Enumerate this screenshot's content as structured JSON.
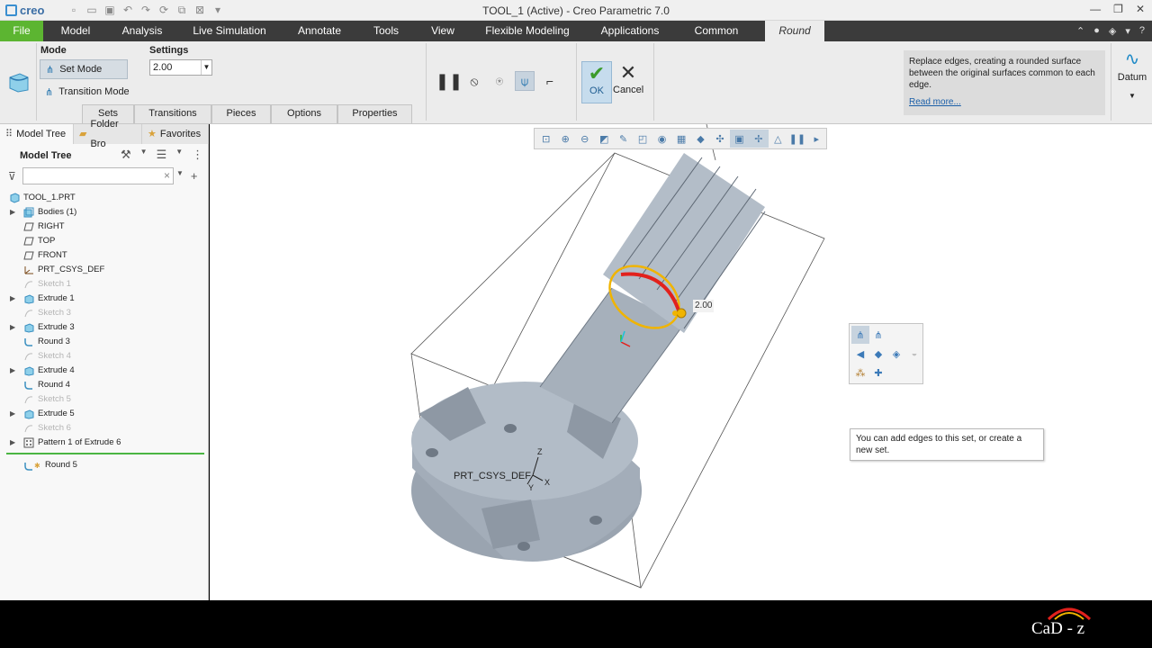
{
  "app": {
    "logo_text": "creo",
    "window_title": "TOOL_1 (Active) - Creo Parametric 7.0"
  },
  "tabs": [
    "File",
    "Model",
    "Analysis",
    "Live Simulation",
    "Annotate",
    "Tools",
    "View",
    "Flexible Modeling",
    "Applications",
    "Common",
    "Round"
  ],
  "ribbon": {
    "mode_label": "Mode",
    "settings_label": "Settings",
    "set_mode": "Set Mode",
    "transition_mode": "Transition Mode",
    "radius_value": "2.00",
    "subtabs": [
      "Sets",
      "Transitions",
      "Pieces",
      "Options",
      "Properties"
    ],
    "ok": "OK",
    "cancel": "Cancel",
    "help_text": "Replace edges, creating a rounded surface between the original surfaces common to each edge.",
    "read_more": "Read more...",
    "datum": "Datum"
  },
  "panel": {
    "tabs": [
      "Model Tree",
      "Folder Bro",
      "Favorites"
    ],
    "header": "Model Tree",
    "search_value": ""
  },
  "tree": [
    {
      "label": "TOOL_1.PRT",
      "dim": false,
      "expand": false
    },
    {
      "label": "Bodies (1)",
      "dim": false,
      "expand": true
    },
    {
      "label": "RIGHT",
      "dim": false,
      "expand": false
    },
    {
      "label": "TOP",
      "dim": false,
      "expand": false
    },
    {
      "label": "FRONT",
      "dim": false,
      "expand": false
    },
    {
      "label": "PRT_CSYS_DEF",
      "dim": false,
      "expand": false
    },
    {
      "label": "Sketch 1",
      "dim": true,
      "expand": false
    },
    {
      "label": "Extrude 1",
      "dim": false,
      "expand": true
    },
    {
      "label": "Sketch 3",
      "dim": true,
      "expand": false
    },
    {
      "label": "Extrude 3",
      "dim": false,
      "expand": true
    },
    {
      "label": "Round 3",
      "dim": false,
      "expand": false
    },
    {
      "label": "Sketch 4",
      "dim": true,
      "expand": false
    },
    {
      "label": "Extrude 4",
      "dim": false,
      "expand": true
    },
    {
      "label": "Round 4",
      "dim": false,
      "expand": false
    },
    {
      "label": "Sketch 5",
      "dim": true,
      "expand": false
    },
    {
      "label": "Extrude 5",
      "dim": false,
      "expand": true
    },
    {
      "label": "Sketch 6",
      "dim": true,
      "expand": false
    },
    {
      "label": "Pattern 1 of Extrude 6",
      "dim": false,
      "expand": true
    }
  ],
  "insert_item": "Round 5",
  "graphics": {
    "dimension_value": "2.00",
    "csys_label": "PRT_CSYS_DEF",
    "axis_x": "X",
    "axis_y": "Y",
    "axis_z": "Z",
    "tooltip": "You can add edges to this set, or create a new set."
  },
  "footer_logo": "CaD - z",
  "colors": {
    "file_tab": "#5cb531",
    "tab_bar": "#3b3b3b",
    "highlight_edge": "#e2211c",
    "selection_ring": "#f0b400",
    "model_body": "#aab4c0"
  }
}
